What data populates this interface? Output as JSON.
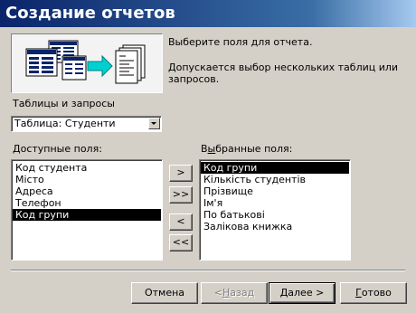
{
  "window": {
    "title": "Создание отчетов"
  },
  "illustration": {
    "name": "tables-to-report-illustration"
  },
  "description": {
    "line1": "Выберите поля для отчета.",
    "line2": "Допускается выбор нескольких таблиц или",
    "line3": "запросов."
  },
  "source": {
    "label": "Таблицы и запросы",
    "selected": "Таблица: Студенти"
  },
  "available": {
    "label_underlined": "Д",
    "label_rest": "оступные поля:",
    "items": [
      "Код студента",
      "Місто",
      "Адреса",
      "Телефон",
      "Код групи"
    ]
  },
  "selected_fields": {
    "label_pre": "В",
    "label_underlined": "ы",
    "label_rest": "бранные поля:",
    "items": [
      "Код групи",
      "Кількість студентів",
      "Прізвище",
      "Ім'я",
      "По батькові",
      "Залікова книжка"
    ]
  },
  "move_buttons": {
    "add_one": ">",
    "add_all": ">>",
    "remove_one": "<",
    "remove_all": "<<"
  },
  "footer": {
    "cancel": "Отмена",
    "back_pre": "< ",
    "back_underlined": "Н",
    "back_rest": "азад",
    "next_underlined": "Д",
    "next_rest": "алее >",
    "finish_underlined": "Г",
    "finish_rest": "отово"
  },
  "colors": {
    "titlebar_start": "#0a246a",
    "titlebar_end": "#a6caf0",
    "selection": "#000000",
    "face": "#d4d0c8"
  }
}
